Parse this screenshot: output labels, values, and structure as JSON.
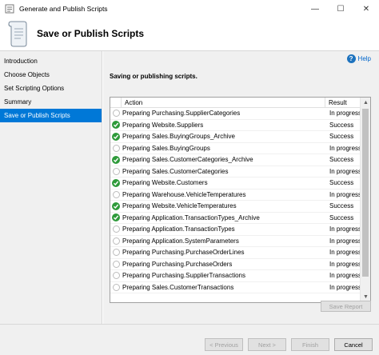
{
  "window": {
    "title": "Generate and Publish Scripts",
    "minimize": "—",
    "maximize": "☐",
    "close": "✕"
  },
  "header": {
    "title": "Save or Publish Scripts"
  },
  "sidebar": {
    "items": [
      {
        "label": "Introduction"
      },
      {
        "label": "Choose Objects"
      },
      {
        "label": "Set Scripting Options"
      },
      {
        "label": "Summary"
      },
      {
        "label": "Save or Publish Scripts"
      }
    ]
  },
  "content": {
    "help_label": "Help",
    "subtitle": "Saving or publishing scripts.",
    "columns": {
      "action": "Action",
      "result": "Result"
    },
    "rows": [
      {
        "status": "progress",
        "action": "Preparing Purchasing.SupplierCategories",
        "result": "In progress"
      },
      {
        "status": "success",
        "action": "Preparing Website.Suppliers",
        "result": "Success"
      },
      {
        "status": "success",
        "action": "Preparing Sales.BuyingGroups_Archive",
        "result": "Success"
      },
      {
        "status": "progress",
        "action": "Preparing Sales.BuyingGroups",
        "result": "In progress"
      },
      {
        "status": "success",
        "action": "Preparing Sales.CustomerCategories_Archive",
        "result": "Success"
      },
      {
        "status": "progress",
        "action": "Preparing Sales.CustomerCategories",
        "result": "In progress"
      },
      {
        "status": "success",
        "action": "Preparing Website.Customers",
        "result": "Success"
      },
      {
        "status": "progress",
        "action": "Preparing Warehouse.VehicleTemperatures",
        "result": "In progress"
      },
      {
        "status": "success",
        "action": "Preparing Website.VehicleTemperatures",
        "result": "Success"
      },
      {
        "status": "success",
        "action": "Preparing Application.TransactionTypes_Archive",
        "result": "Success"
      },
      {
        "status": "progress",
        "action": "Preparing Application.TransactionTypes",
        "result": "In progress"
      },
      {
        "status": "progress",
        "action": "Preparing Application.SystemParameters",
        "result": "In progress"
      },
      {
        "status": "progress",
        "action": "Preparing Purchasing.PurchaseOrderLines",
        "result": "In progress"
      },
      {
        "status": "progress",
        "action": "Preparing Purchasing.PurchaseOrders",
        "result": "In progress"
      },
      {
        "status": "progress",
        "action": "Preparing Purchasing.SupplierTransactions",
        "result": "In progress"
      },
      {
        "status": "progress",
        "action": "Preparing Sales.CustomerTransactions",
        "result": "In progress"
      }
    ],
    "save_report_label": "Save Report"
  },
  "footer": {
    "previous_label": "< Previous",
    "next_label": "Next >",
    "finish_label": "Finish",
    "cancel_label": "Cancel"
  },
  "colors": {
    "selection": "#0078d7",
    "success": "#2e9a3a",
    "help_link": "#0066cc"
  }
}
